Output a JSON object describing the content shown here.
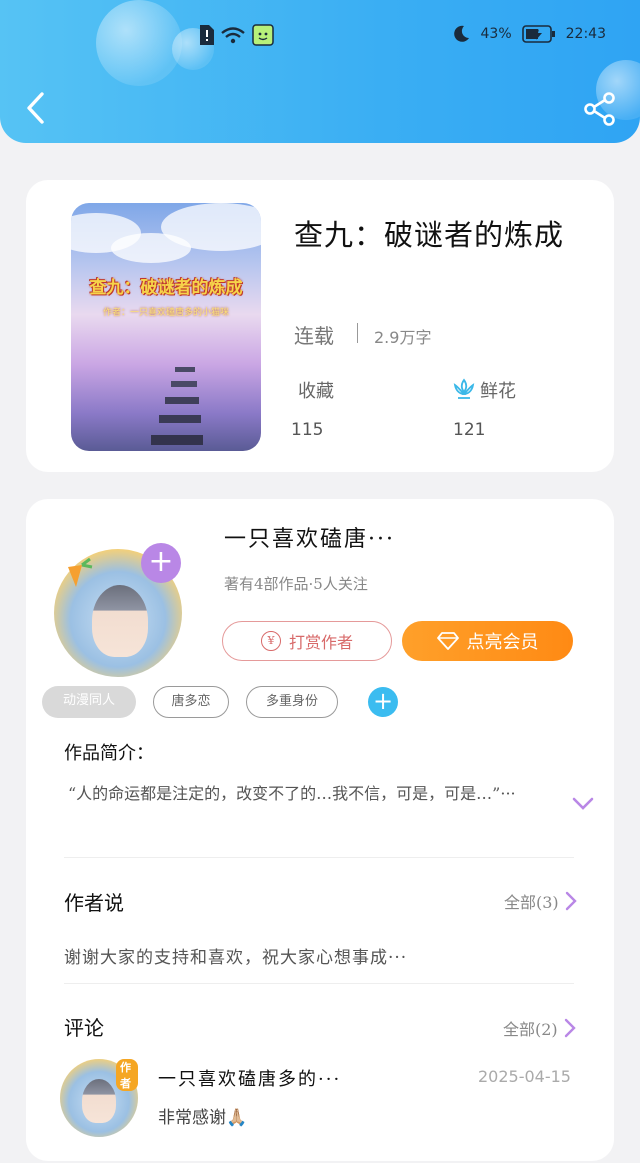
{
  "status_bar": {
    "battery_percent": "43%",
    "time": "22:43"
  },
  "book": {
    "cover_title": "查九：破谜者的炼成",
    "cover_subtitle": "作者：一只喜欢磕唐多的小猫咪",
    "title": "查九：破谜者的炼成",
    "status": "连载",
    "word_count": "2.9万字",
    "collect_label": "收藏",
    "collect_value": "115",
    "flower_label": "鲜花",
    "flower_value": "121"
  },
  "author": {
    "name": "一只喜欢磕唐···",
    "meta": "著有4部作品·5人关注",
    "reward_label": "打赏作者",
    "vip_label": "点亮会员",
    "tags": [
      "动漫同人",
      "唐多恋",
      "多重身份"
    ]
  },
  "intro": {
    "label": "作品简介：",
    "text": "“人的命运都是注定的，改变不了的…我不信，可是，可是…”···"
  },
  "author_says": {
    "label": "作者说",
    "all_label": "全部(3)",
    "text": "谢谢大家的支持和喜欢，祝大家心想事成···"
  },
  "comments": {
    "label": "评论",
    "all_label": "全部(2)",
    "items": [
      {
        "badge": "作者",
        "name": "一只喜欢磕唐多的···",
        "date": "2025-04-15",
        "text": "非常感谢🙏🏼"
      }
    ]
  },
  "colors": {
    "header_start": "#56c3f4",
    "header_end": "#2fa4f3",
    "vip_orange": "#ff8a14",
    "reward_red": "#d86a6a",
    "accent_purple": "#b987e6",
    "accent_blue": "#3bbcf0"
  },
  "icons": [
    "back-icon",
    "share-icon",
    "moon-icon",
    "battery-icon",
    "wifi-icon",
    "flower-icon",
    "diamond-icon",
    "yen-icon",
    "plus-icon",
    "chevron-down-icon",
    "chevron-right-icon"
  ]
}
